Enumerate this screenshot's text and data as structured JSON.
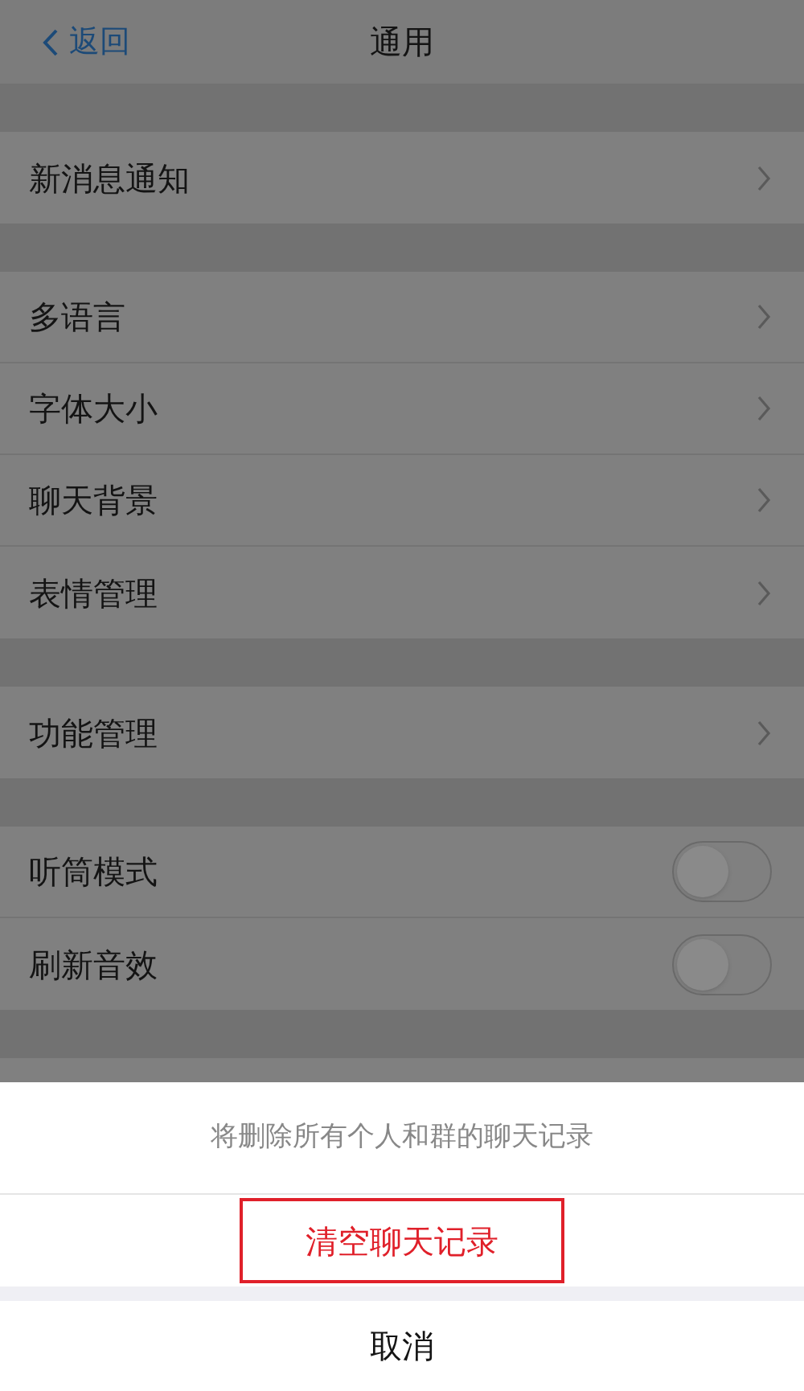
{
  "nav": {
    "back": "返回",
    "title": "通用"
  },
  "sections": [
    {
      "rows": [
        {
          "label": "新消息通知",
          "kind": "link"
        }
      ]
    },
    {
      "rows": [
        {
          "label": "多语言",
          "kind": "link"
        },
        {
          "label": "字体大小",
          "kind": "link"
        },
        {
          "label": "聊天背景",
          "kind": "link"
        },
        {
          "label": "表情管理",
          "kind": "link"
        }
      ]
    },
    {
      "rows": [
        {
          "label": "功能管理",
          "kind": "link"
        }
      ]
    },
    {
      "rows": [
        {
          "label": "听筒模式",
          "kind": "toggle",
          "on": false
        },
        {
          "label": "刷新音效",
          "kind": "toggle",
          "on": false
        }
      ]
    }
  ],
  "action_sheet": {
    "message": "将删除所有个人和群的聊天记录",
    "action": {
      "label": "清空聊天记录",
      "highlighted": true
    },
    "cancel": "取消"
  }
}
